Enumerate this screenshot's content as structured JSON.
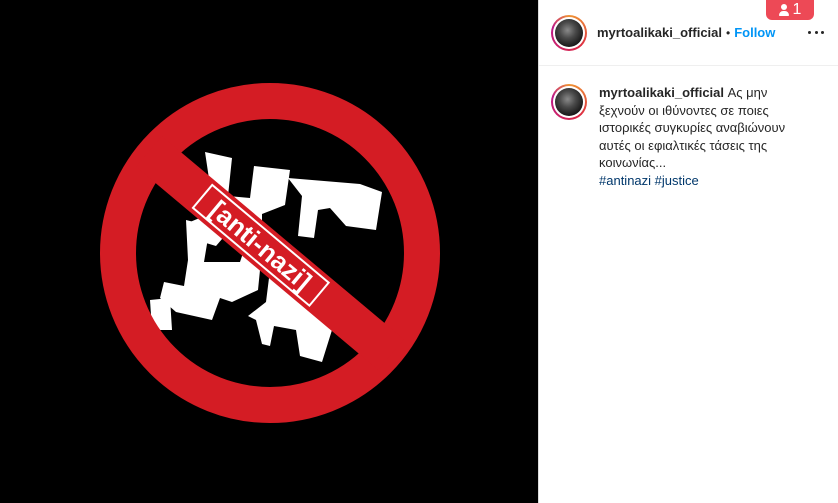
{
  "post": {
    "author": "myrtoalikaki_official",
    "follow_label": "Follow",
    "separator": "•",
    "caption_text": "Ας μην ξεχνούν οι ιθύνοντες σε ποιες ιστορικές συγκυρίες αναβιώνουν αυτές οι εφιαλτικές τάσεις της κοινωνίας...",
    "hashtags": [
      "#antinazi",
      "#justice"
    ]
  },
  "image": {
    "banner_text": "[anti-nazi]",
    "background": "#000000",
    "ring_color": "#d41c24"
  },
  "notification": {
    "count": "1",
    "color": "#ed4956"
  },
  "colors": {
    "link": "#0095f6",
    "hashtag": "#00376b",
    "text": "#262626"
  },
  "icons": {
    "more": "more-options-icon",
    "notification": "person-notification-icon"
  }
}
